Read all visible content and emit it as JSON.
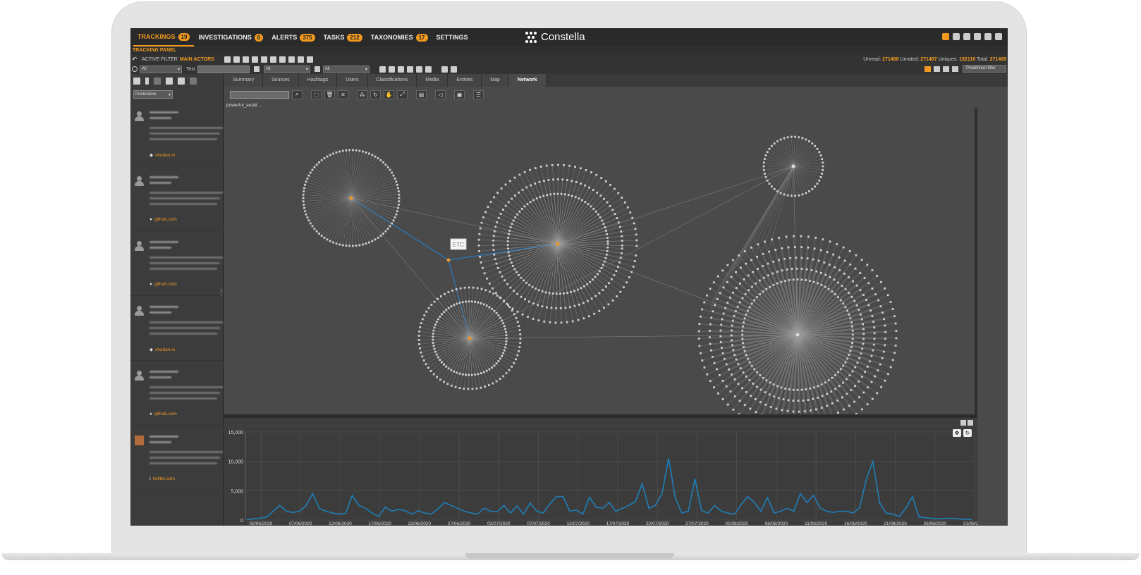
{
  "nav": {
    "items": [
      {
        "label": "TRACKINGS",
        "badge": "19",
        "active": true
      },
      {
        "label": "INVESTIGATIONS",
        "badge": "0",
        "active": false
      },
      {
        "label": "ALERTS",
        "badge": "375",
        "active": false
      },
      {
        "label": "TASKS",
        "badge": "212",
        "active": false
      },
      {
        "label": "TAXONOMIES",
        "badge": "17",
        "active": false
      },
      {
        "label": "SETTINGS",
        "badge": "",
        "active": false
      }
    ],
    "logo_text": "Constella",
    "panel_label": "TRACKING PANEL"
  },
  "filter": {
    "active_filter_label": "ACTIVE FILTER",
    "active_filter_value": "MAIN ACTORS",
    "text_label": "Text",
    "select_all_1": "All",
    "select_all_2": "All",
    "select_all_3": "All",
    "predefined_filter": "Predefined filter"
  },
  "counters": {
    "unread_label": "Unread:",
    "unread": "271488",
    "unrated_label": "Unrated:",
    "unrated": "271487",
    "uniques_label": "Uniques:",
    "uniques": "182118",
    "total_label": "Total:",
    "total": "271488"
  },
  "feed": {
    "publication_select": "Publication",
    "items": [
      {
        "source": "shodan.io",
        "source_icon": "tag-icon"
      },
      {
        "source": "github.com",
        "source_icon": "github-icon"
      },
      {
        "source": "github.com",
        "source_icon": "github-icon"
      },
      {
        "source": "shodan.io",
        "source_icon": "tag-icon"
      },
      {
        "source": "github.com",
        "source_icon": "github-icon"
      },
      {
        "source": "twitter.com",
        "source_icon": "twitter-icon"
      }
    ]
  },
  "tabs": [
    "Summary",
    "Sources",
    "Hashtags",
    "Users",
    "Classifications",
    "Media",
    "Entities",
    "Map",
    "Network"
  ],
  "active_tab": "Network",
  "network": {
    "graph_label": "powerful_analit ...",
    "tooltip": "ETC",
    "accent": "#f29a1f",
    "edge_highlight": "#2a7bbf",
    "node_color": "#cfcfcf"
  },
  "chart_data": {
    "type": "line",
    "ylim": [
      0,
      15000
    ],
    "yticks": [
      "15,000",
      "10,000",
      "5,000",
      "0"
    ],
    "ytick_values": [
      15000,
      10000,
      5000,
      0
    ],
    "xticks": [
      "02/06/2020",
      "07/06/2020",
      "12/06/2020",
      "17/06/2020",
      "22/06/2020",
      "27/06/2020",
      "02/07/2020",
      "07/07/2020",
      "12/07/2020",
      "17/07/2020",
      "22/07/2020",
      "27/07/2020",
      "01/08/2020",
      "06/08/2020",
      "11/08/2020",
      "16/08/2020",
      "21/08/2020",
      "26/08/2020",
      "31/08/2020"
    ],
    "series_color": "#1f7fb8",
    "values": [
      100,
      200,
      300,
      500,
      1500,
      2500,
      1500,
      1300,
      1500,
      2500,
      4500,
      2000,
      1500,
      1200,
      1000,
      1100,
      4200,
      2500,
      2000,
      1200,
      600,
      2200,
      1500,
      1800,
      1600,
      1000,
      1600,
      1200,
      1000,
      1900,
      3000,
      2500,
      2000,
      1500,
      1200,
      1000,
      2000,
      1500,
      1400,
      2500,
      1200,
      2400,
      1000,
      2900,
      1500,
      1200,
      2800,
      4000,
      4000,
      1500,
      1700,
      1000,
      3900,
      2200,
      2000,
      3000,
      1500,
      2000,
      2500,
      3200,
      6200,
      2000,
      2500,
      4500,
      10500,
      3800,
      1200,
      1500,
      7000,
      1600,
      1200,
      2500,
      1500,
      1200,
      1000,
      2600,
      4000,
      3000,
      1500,
      3800,
      1200,
      1500,
      2000,
      1500,
      4500,
      3000,
      4200,
      2000,
      1500,
      1300,
      1500,
      1500,
      1200,
      2100,
      7000,
      10000,
      3000,
      1200,
      1000,
      600,
      2000,
      4000,
      500,
      400,
      300,
      200,
      300,
      300,
      200,
      150,
      100
    ]
  }
}
